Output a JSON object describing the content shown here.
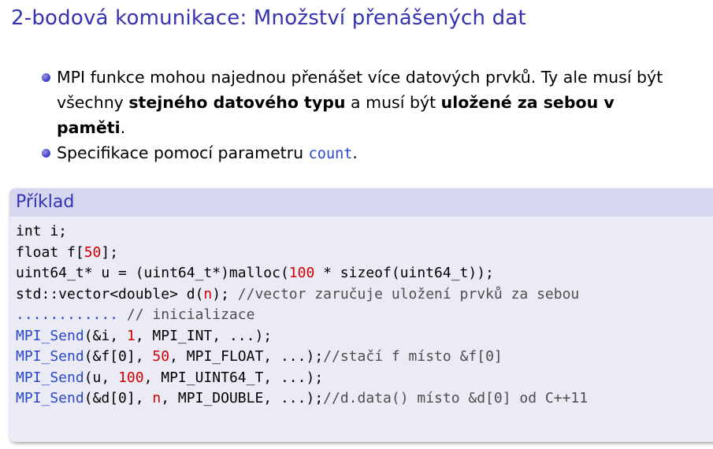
{
  "title": "2-bodová komunikace: Množství přenášených dat",
  "bullets": [
    {
      "parts": [
        {
          "t": "MPI funkce mohou najednou přenášet více datových prvků. Ty ale musí být všechny ",
          "s": "n"
        },
        {
          "t": "stejného datového typu",
          "s": "b"
        },
        {
          "t": " a musí být ",
          "s": "n"
        },
        {
          "t": "uložené za sebou v paměti",
          "s": "b"
        },
        {
          "t": ".",
          "s": "n"
        }
      ]
    },
    {
      "parts": [
        {
          "t": "Specifikace pomocí parametru ",
          "s": "n"
        },
        {
          "t": "count",
          "s": "c"
        },
        {
          "t": ".",
          "s": "n"
        }
      ]
    }
  ],
  "example": {
    "heading": "Příklad",
    "lines": [
      [
        {
          "t": "int i;",
          "k": ""
        }
      ],
      [
        {
          "t": "float f[",
          "k": ""
        },
        {
          "t": "50",
          "k": "num"
        },
        {
          "t": "];",
          "k": ""
        }
      ],
      [
        {
          "t": "uint64_t* u = (uint64_t*)malloc(",
          "k": ""
        },
        {
          "t": "100",
          "k": "num"
        },
        {
          "t": " * sizeof(uint64_t));",
          "k": ""
        }
      ],
      [
        {
          "t": "std::vector<double> d(",
          "k": ""
        },
        {
          "t": "n",
          "k": "num"
        },
        {
          "t": "); ",
          "k": ""
        },
        {
          "t": "//vector zaručuje uložení prvků za sebou",
          "k": "cmt"
        }
      ],
      [
        {
          "t": "............ ",
          "k": "fn"
        },
        {
          "t": "// inicializace",
          "k": "cmt"
        }
      ],
      [
        {
          "t": "MPI_Send",
          "k": "fn"
        },
        {
          "t": "(&i, ",
          "k": ""
        },
        {
          "t": "1",
          "k": "num"
        },
        {
          "t": ", MPI_INT, ...);",
          "k": ""
        }
      ],
      [
        {
          "t": "MPI_Send",
          "k": "fn"
        },
        {
          "t": "(&f[0], ",
          "k": ""
        },
        {
          "t": "50",
          "k": "num"
        },
        {
          "t": ", MPI_FLOAT, ...);",
          "k": ""
        },
        {
          "t": "//stačí f místo &f[0]",
          "k": "cmt"
        }
      ],
      [
        {
          "t": "MPI_Send",
          "k": "fn"
        },
        {
          "t": "(u, ",
          "k": ""
        },
        {
          "t": "100",
          "k": "num"
        },
        {
          "t": ", MPI_UINT64_T, ...);",
          "k": ""
        }
      ],
      [
        {
          "t": "MPI_Send",
          "k": "fn"
        },
        {
          "t": "(&d[0], ",
          "k": ""
        },
        {
          "t": "n",
          "k": "num"
        },
        {
          "t": ", MPI_DOUBLE, ...);",
          "k": ""
        },
        {
          "t": "//d.data() místo &d[0] od C++11",
          "k": "cmt"
        }
      ]
    ]
  }
}
